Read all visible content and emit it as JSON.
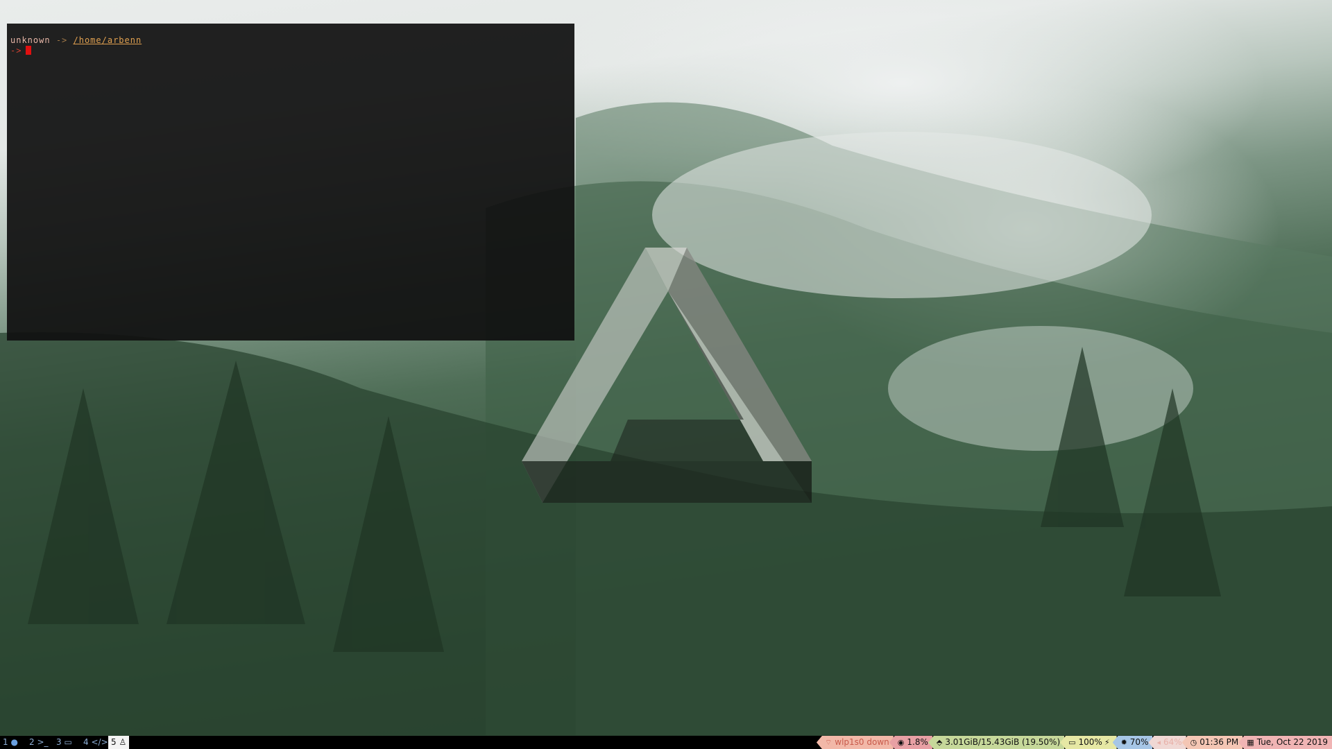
{
  "terminal": {
    "user": "unknown",
    "arrow": "->",
    "path": "/home/arbenn",
    "prompt": "->"
  },
  "workspaces": [
    {
      "num": "1",
      "icon": "globe-icon",
      "glyph": "●",
      "active": false
    },
    {
      "num": "2",
      "icon": "terminal-icon",
      "glyph": ">_",
      "active": false
    },
    {
      "num": "3",
      "icon": "folder-icon",
      "glyph": "▭",
      "active": false
    },
    {
      "num": "4",
      "icon": "code-icon",
      "glyph": "</>",
      "active": false
    },
    {
      "num": "5",
      "icon": "linux-icon",
      "glyph": "♙",
      "active": true
    }
  ],
  "status": {
    "network": {
      "text": "wlp1s0 down",
      "icon": "wifi-icon",
      "glyph": "⌔",
      "color": "#f2b8a8"
    },
    "cpu": {
      "text": "1.8%",
      "icon": "speedometer-icon",
      "glyph": "◉",
      "color": "#e8a0a4"
    },
    "memory": {
      "text": "3.01GiB/15.43GiB (19.50%)",
      "icon": "memory-icon",
      "glyph": "⬘",
      "color": "#c6d89a"
    },
    "battery": {
      "text": "100%",
      "icon": "battery-icon",
      "glyph": "▭",
      "glyph2": "⚡",
      "color": "#e6e8a4"
    },
    "brightness": {
      "text": "70%",
      "icon": "brightness-icon",
      "glyph": "✹",
      "color": "#a6c6e6"
    },
    "volume": {
      "text": "64%",
      "icon": "volume-icon",
      "glyph": "◂",
      "color": "#f0d8d4"
    },
    "time": {
      "text": "01:36 PM",
      "icon": "clock-icon",
      "glyph": "◷",
      "color": "#f4c6b4"
    },
    "date": {
      "text": "Tue, Oct 22 2019",
      "icon": "calendar-icon",
      "glyph": "▦",
      "color": "#f0b4b4"
    }
  }
}
